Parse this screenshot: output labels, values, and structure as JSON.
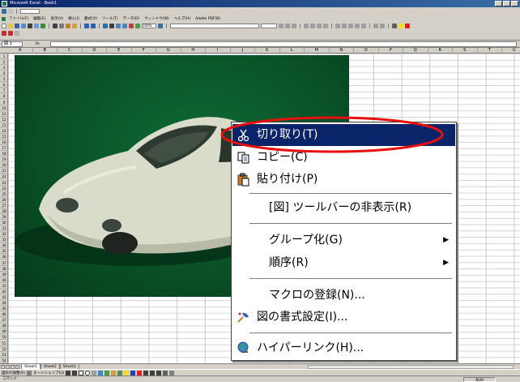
{
  "window": {
    "title": "Microsoft Excel - Book1"
  },
  "menu": [
    "ファイル(F)",
    "編集(E)",
    "表示(V)",
    "挿入(I)",
    "書式(O)",
    "ツール(T)",
    "データ(D)",
    "ウィンドウ(W)",
    "ヘルプ(H)",
    "Adobe PDF(B)"
  ],
  "toolbar": {
    "zoom": "100%"
  },
  "formula_bar": {
    "name_box": "図 1",
    "fx": "fx"
  },
  "columns": [
    "A",
    "B",
    "C",
    "D",
    "E",
    "F",
    "G",
    "H",
    "I",
    "J",
    "K",
    "L",
    "M",
    "N",
    "O",
    "P",
    "Q",
    "R",
    "S",
    "T",
    "U"
  ],
  "sheets": [
    "Sheet1",
    "Sheet2",
    "Sheet3"
  ],
  "draw_bar": {
    "draw_label": "図形の調整(R)",
    "autoshapes_label": "オートシェイプ(U)"
  },
  "status": {
    "text": "コマンド",
    "mode": "NUM"
  },
  "context_menu": {
    "items": [
      {
        "label": "切り取り(T)",
        "icon": "scissors-icon",
        "highlighted": true
      },
      {
        "label": "コピー(C)",
        "icon": "copy-icon"
      },
      {
        "label": "貼り付け(P)",
        "icon": "paste-icon"
      },
      {
        "label": "[図] ツールバーの非表示(R)"
      },
      {
        "label": "グループ化(G)",
        "submenu": true
      },
      {
        "label": "順序(R)",
        "submenu": true
      },
      {
        "label": "マクロの登録(N)..."
      },
      {
        "label": "図の書式設定(I)...",
        "icon": "format-picture-icon"
      },
      {
        "label": "ハイパーリンク(H)...",
        "icon": "hyperlink-globe-icon"
      }
    ]
  },
  "colors": {
    "highlight": "#0a246a",
    "annotation": "#e8100e",
    "menu_bg": "#ffffff",
    "chrome": "#d4d0c8"
  }
}
